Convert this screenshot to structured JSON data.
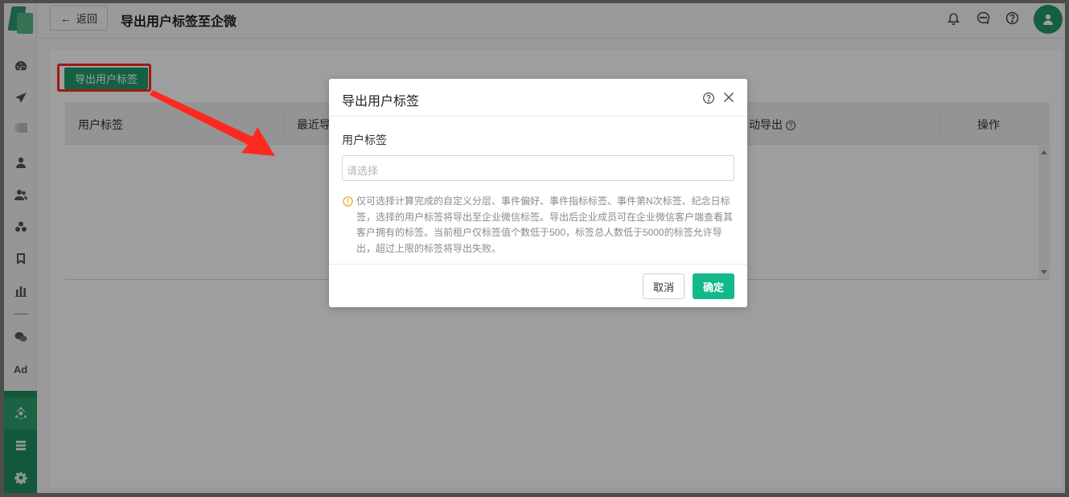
{
  "header": {
    "back_label": "返回",
    "page_title": "导出用户标签至企微",
    "icons": [
      "bell-icon",
      "message-icon",
      "help-icon",
      "user-avatar-icon"
    ]
  },
  "sidebar": {
    "icons": [
      "dashboard-icon",
      "send-icon",
      "segment-icon",
      "user-icon",
      "users-icon",
      "group-icon",
      "bookmark-icon",
      "bar-chart-icon",
      "wechat-icon",
      "ad-icon",
      "network-icon",
      "list-icon",
      "gear-icon"
    ],
    "ad_label": "Ad"
  },
  "main": {
    "export_button_label": "导出用户标签",
    "table": {
      "columns": [
        "用户标签",
        "最近导",
        "动导出",
        "操作"
      ]
    }
  },
  "modal": {
    "title": "导出用户标签",
    "field_label": "用户标签",
    "select_placeholder": "请选择",
    "notice": "仅可选择计算完成的自定义分层、事件偏好、事件指标标签、事件第N次标签、纪念日标签，选择的用户标签将导出至企业微信标签。导出后企业成员可在企业微信客户端查看其客户拥有的标签。当前租户仅标签值个数低于500，标签总人数低于5000的标签允许导出，超过上限的标签将导出失败。",
    "cancel_label": "取消",
    "confirm_label": "确定"
  },
  "colors": {
    "brand_green": "#1f9b6c",
    "confirm_green": "#13b98a",
    "highlight_red": "#ff2a1f",
    "warning_orange": "#f0a020"
  }
}
